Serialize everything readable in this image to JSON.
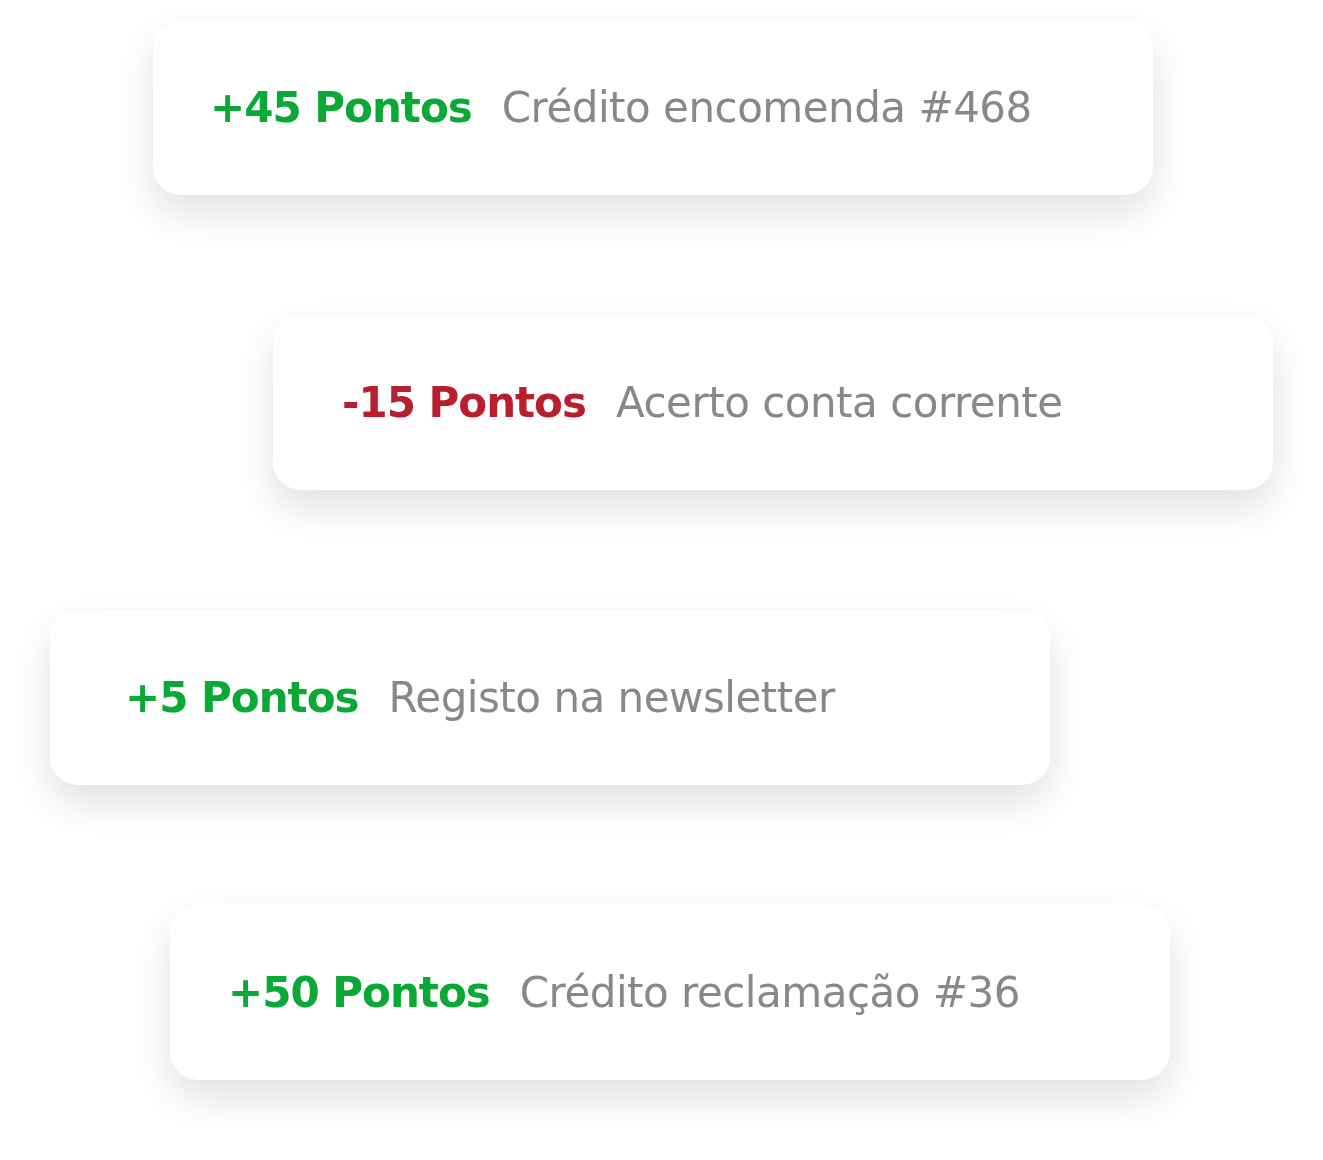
{
  "transactions": [
    {
      "amount": "+45 Pontos",
      "description": "Crédito encomenda #468",
      "color": "#0aa834"
    },
    {
      "amount": "-15 Pontos",
      "description": "Acerto conta corrente",
      "color": "#b71f2e"
    },
    {
      "amount": "+5 Pontos",
      "description": "Registo na newsletter",
      "color": "#0aa834"
    },
    {
      "amount": "+50 Pontos",
      "description": "Crédito reclamação #36",
      "color": "#0aa834"
    }
  ]
}
